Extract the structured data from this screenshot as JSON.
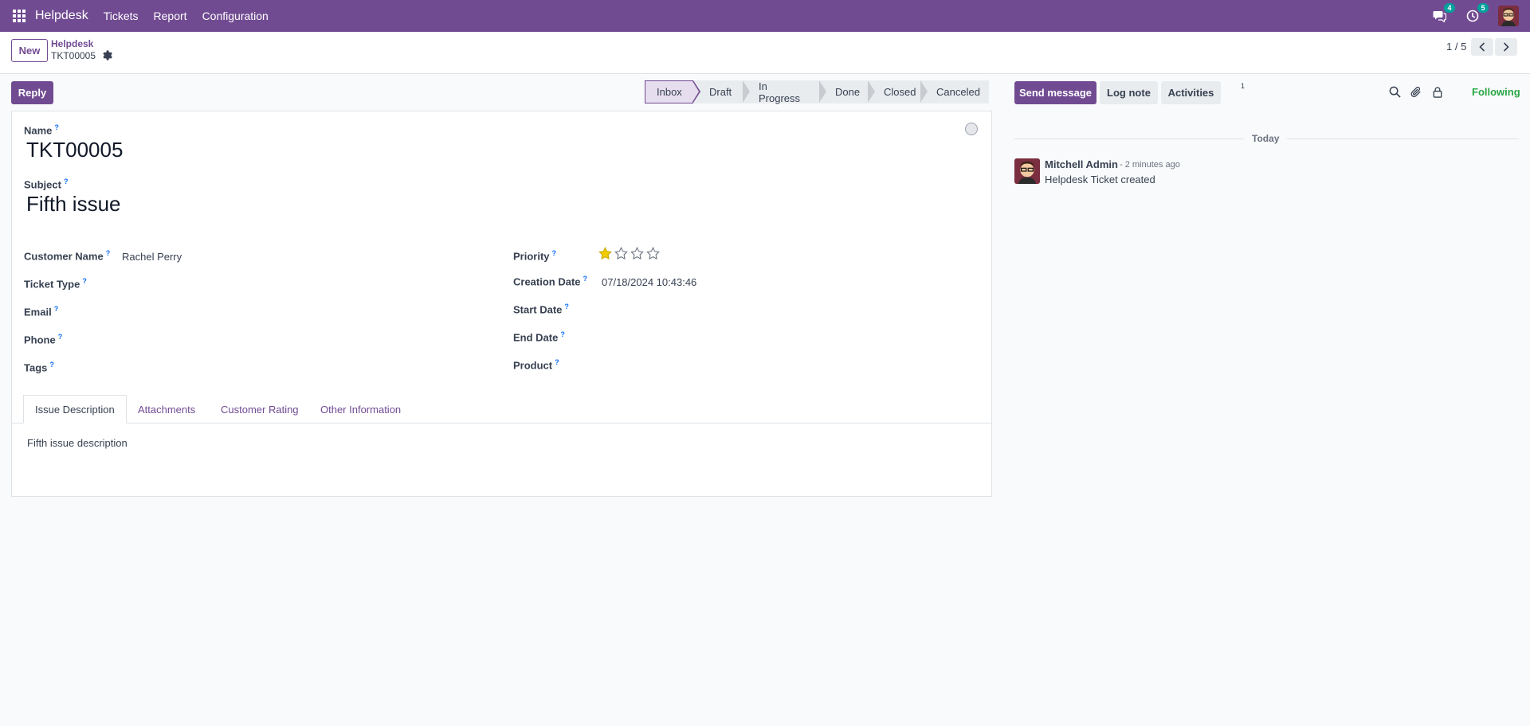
{
  "navbar": {
    "brand": "Helpdesk",
    "menu": [
      "Tickets",
      "Report",
      "Configuration"
    ],
    "messages_badge": "4",
    "activities_badge": "5"
  },
  "control_panel": {
    "new_label": "New",
    "breadcrumb_parent": "Helpdesk",
    "breadcrumb_current": "TKT00005",
    "pager": "1 / 5"
  },
  "form": {
    "reply_label": "Reply",
    "stages": [
      "Inbox",
      "Draft",
      "In Progress",
      "Done",
      "Closed",
      "Canceled"
    ],
    "active_stage": "Inbox",
    "name_label": "Name",
    "name_value": "TKT00005",
    "subject_label": "Subject",
    "subject_value": "Fifth issue",
    "left_fields": [
      {
        "label": "Customer Name",
        "value": "Rachel Perry"
      },
      {
        "label": "Ticket Type",
        "value": ""
      },
      {
        "label": "Email",
        "value": ""
      },
      {
        "label": "Phone",
        "value": ""
      },
      {
        "label": "Tags",
        "value": ""
      }
    ],
    "right_fields": [
      {
        "label": "Priority",
        "value": ""
      },
      {
        "label": "Creation Date",
        "value": "07/18/2024 10:43:46"
      },
      {
        "label": "Start Date",
        "value": ""
      },
      {
        "label": "End Date",
        "value": ""
      },
      {
        "label": "Product",
        "value": ""
      }
    ],
    "priority_stars_filled": 1,
    "priority_stars_total": 4,
    "help_marker": "?",
    "tabs": [
      "Issue Description",
      "Attachments",
      "Customer Rating",
      "Other Information"
    ],
    "active_tab": "Issue Description",
    "description": "Fifth issue description"
  },
  "chatter": {
    "send_message": "Send message",
    "log_note": "Log note",
    "activities": "Activities",
    "followers_count": "1",
    "following": "Following",
    "today": "Today",
    "message": {
      "author": "Mitchell Admin",
      "time": "- 2 minutes ago",
      "body": "Helpdesk Ticket created"
    }
  },
  "colors": {
    "brand": "#714b92",
    "following": "#28a745",
    "badge": "#00a09d",
    "star": "#f3cc00"
  }
}
